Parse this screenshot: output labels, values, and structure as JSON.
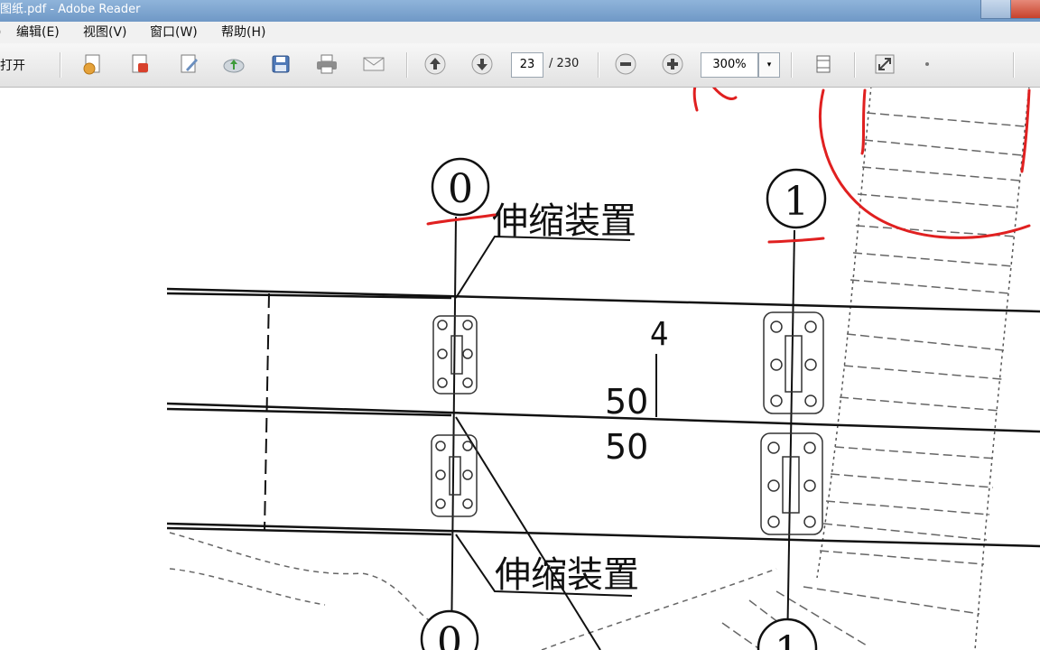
{
  "window": {
    "title": "图纸.pdf - Adobe Reader"
  },
  "menu": {
    "items": [
      {
        "label": "编辑(E)"
      },
      {
        "label": "视图(V)"
      },
      {
        "label": "窗口(W)"
      },
      {
        "label": "帮助(H)"
      }
    ]
  },
  "toolbar": {
    "open_label": "打开",
    "page_current": "23",
    "page_total": "/ 230",
    "zoom": "300%",
    "zoom_dropdown": "▾"
  },
  "drawing": {
    "axis_top_left": "0",
    "axis_top_right": "1",
    "axis_bottom_left": "0",
    "axis_bottom_right": "1",
    "label_top": "伸缩装置",
    "label_bottom": "伸缩装置",
    "dim_4": "4",
    "dim_50_top": "50",
    "dim_50_bottom": "50"
  },
  "colors": {
    "annotation": "#e02020",
    "line": "#111111"
  }
}
